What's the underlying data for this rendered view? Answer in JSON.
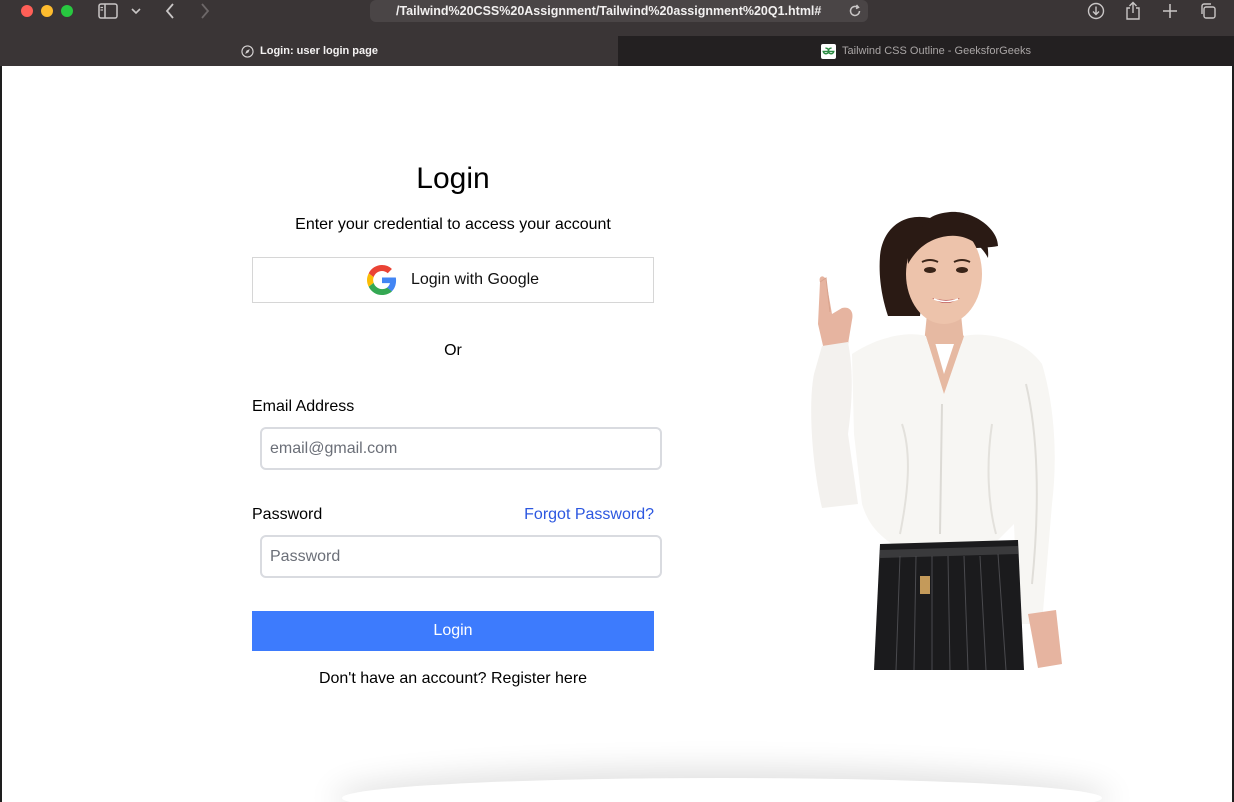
{
  "browser": {
    "url": "/Tailwind%20CSS%20Assignment/Tailwind%20assignment%20Q1.html#",
    "tabs": [
      {
        "label": "Login: user login page",
        "active": true
      },
      {
        "label": "Tailwind CSS Outline - GeeksforGeeks",
        "active": false
      }
    ]
  },
  "login": {
    "title": "Login",
    "subtitle": "Enter your credential to access your account",
    "google_button": "Login with Google",
    "separator": "Or",
    "email": {
      "label": "Email Address",
      "placeholder": "email@gmail.com",
      "value": ""
    },
    "password": {
      "label": "Password",
      "placeholder": "Password",
      "value": ""
    },
    "forgot_link": "Forgot Password?",
    "submit_button": "Login",
    "register_text": "Don't have an account? Register here"
  },
  "colors": {
    "primary_button": "#3d7bfd",
    "link": "#2c57e0",
    "window_chrome": "#3a3536"
  },
  "icons": [
    "sidebar-icon",
    "chevron-down-icon",
    "back-arrow-icon",
    "forward-arrow-icon",
    "reload-icon",
    "download-icon",
    "share-icon",
    "plus-icon",
    "tabs-overview-icon",
    "compass-icon",
    "geeksforgeeks-icon",
    "google-icon"
  ]
}
